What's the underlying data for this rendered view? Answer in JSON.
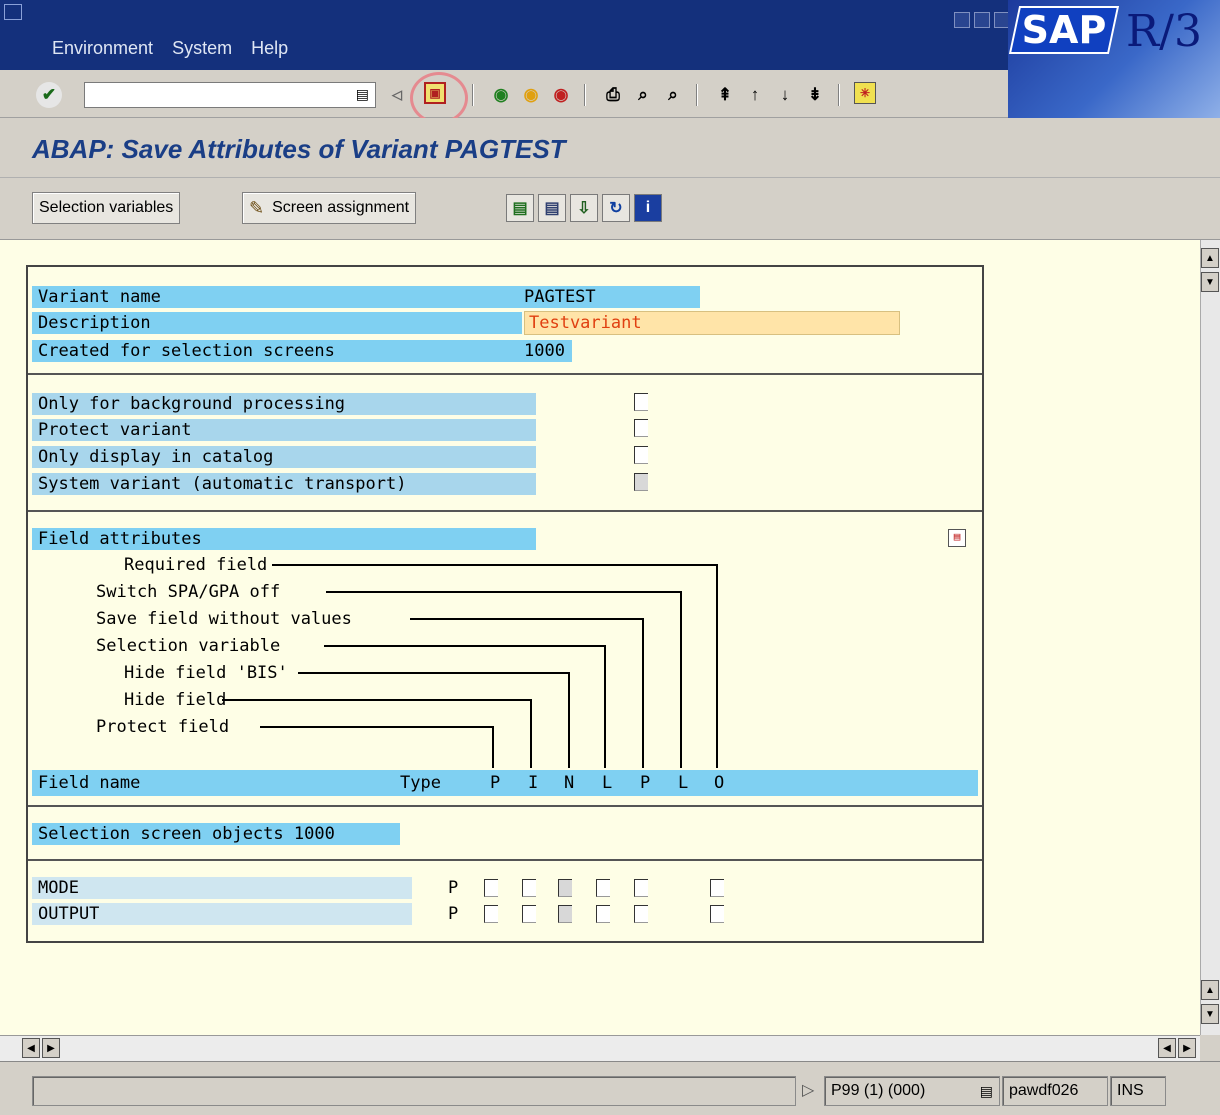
{
  "menu": {
    "environment": "Environment",
    "system": "System",
    "help": "Help"
  },
  "branding": {
    "sap": "SAP",
    "release": "R/3"
  },
  "standard_toolbar": {
    "icons": [
      "enter-icon",
      "back-arrow-icon",
      "save-icon",
      "back-icon",
      "exit-icon",
      "cancel-icon",
      "print-icon",
      "find-icon",
      "find-next-icon",
      "first-page-icon",
      "previous-page-icon",
      "next-page-icon",
      "last-page-icon",
      "customize-layout-icon"
    ]
  },
  "page": {
    "title": "ABAP: Save Attributes of Variant PAGTEST"
  },
  "app_toolbar": {
    "selection_variables": "Selection variables",
    "screen_assignment": "Screen assignment"
  },
  "variant": {
    "name_label": "Variant name",
    "name_value": "PAGTEST",
    "description_label": "Description",
    "description_value": "Testvariant",
    "screens_label": "Created for selection screens",
    "screens_value": "1000"
  },
  "options": [
    {
      "label": "Only for background processing",
      "checked": false
    },
    {
      "label": "Protect variant",
      "checked": false
    },
    {
      "label": "Only display in catalog",
      "checked": false
    },
    {
      "label": "System variant (automatic transport)",
      "checked": false
    }
  ],
  "field_attributes": {
    "title": "Field attributes",
    "items": [
      "Required field",
      "Switch SPA/GPA off",
      "Save field without values",
      "Selection variable",
      "Hide field 'BIS'",
      "Hide field",
      "Protect field"
    ],
    "header": {
      "field_name": "Field name",
      "type": "Type",
      "cols": [
        "P",
        "I",
        "N",
        "L",
        "P",
        "L",
        "O"
      ]
    }
  },
  "objects": {
    "title": "Selection screen objects 1000",
    "rows": [
      {
        "name": "MODE",
        "type": "P"
      },
      {
        "name": "OUTPUT",
        "type": "P"
      }
    ]
  },
  "status": {
    "system": "P99 (1) (000)",
    "server": "pawdf026",
    "mode": "INS"
  },
  "colors": {
    "title_bar": "#14307c",
    "work_area": "#fefee6",
    "label_blue": "#7fd0f2",
    "page_title": "#1a3e86",
    "input_highlight": "#ffe4a8"
  }
}
